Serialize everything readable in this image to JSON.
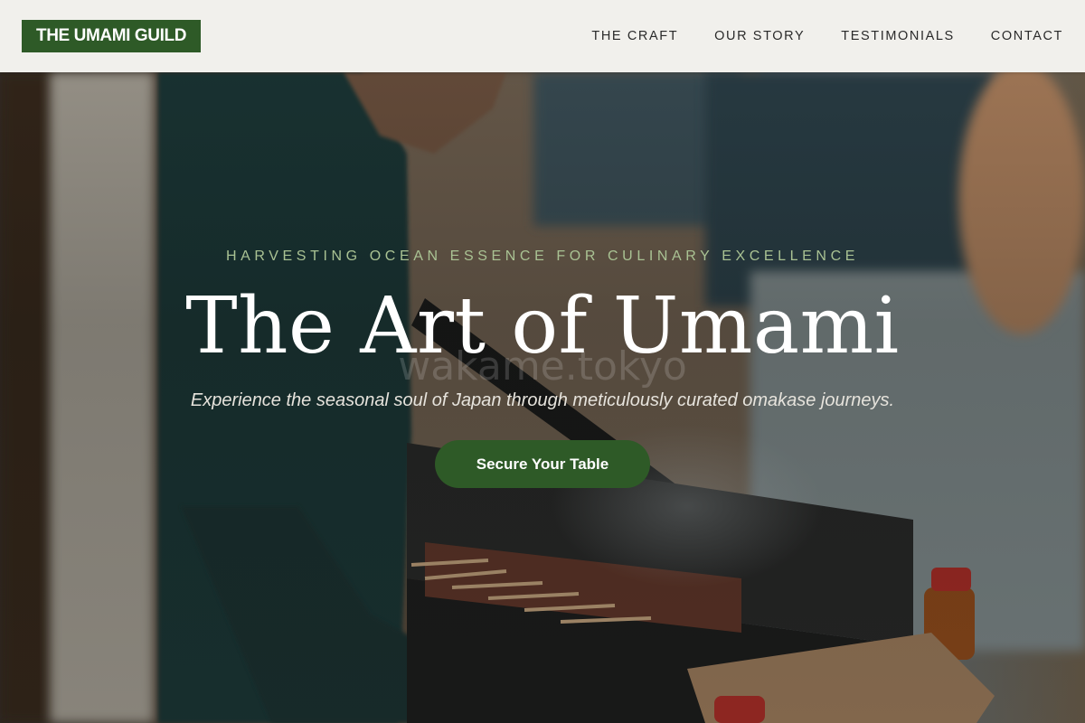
{
  "header": {
    "logo_text": "THE UMAMI GUILD",
    "nav": [
      {
        "label": "THE CRAFT"
      },
      {
        "label": "OUR STORY"
      },
      {
        "label": "TESTIMONIALS"
      },
      {
        "label": "CONTACT"
      }
    ]
  },
  "hero": {
    "tagline": "HARVESTING OCEAN ESSENCE FOR CULINARY EXCELLENCE",
    "title": "The Art of Umami",
    "watermark": "wakame.tokyo",
    "subtitle": "Experience the seasonal soul of Japan through meticulously curated omakase journeys.",
    "cta_label": "Secure Your Table"
  },
  "colors": {
    "brand_green": "#2e5a27",
    "tagline_green": "#a9c293",
    "header_bg": "#f1f0ec"
  }
}
